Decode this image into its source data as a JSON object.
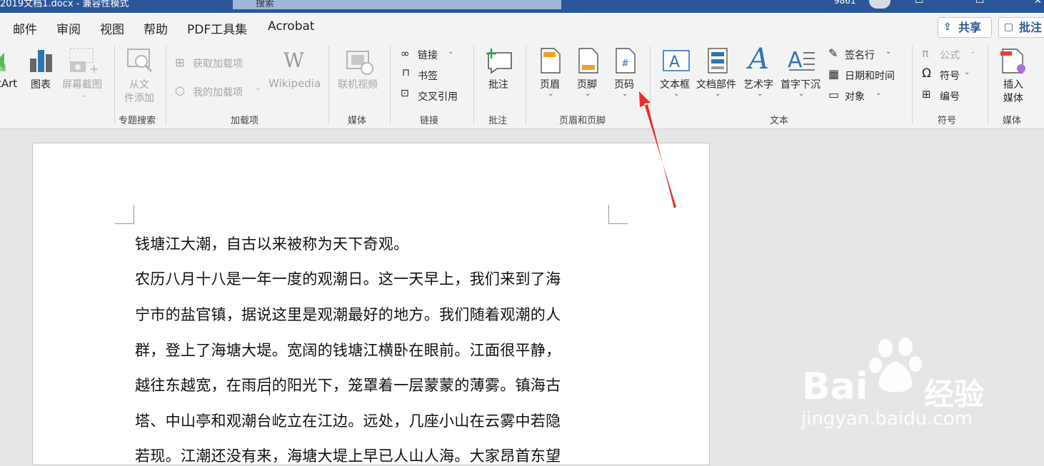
{
  "titlebar": {
    "left_text": "2019文档1.docx - 兼容性模式",
    "search_placeholder": "搜索",
    "user": "9861"
  },
  "tabs": [
    "邮件",
    "审阅",
    "视图",
    "帮助",
    "PDF工具集",
    "Acrobat"
  ],
  "share_label": "共享",
  "comment_label": "批注",
  "ribbon": {
    "smartart": "tArt",
    "chart": "图表",
    "screenshot": "屏幕截图",
    "from_file": [
      "从文",
      "件添加"
    ],
    "get_addins": "获取加载项",
    "my_addins": "我的加载项",
    "wikipedia": "Wikipedia",
    "online_video": "联机视频",
    "link": "链接",
    "bookmark": "书签",
    "cross_ref": "交叉引用",
    "comment": "批注",
    "header": "页眉",
    "footer": "页脚",
    "page_number": "页码",
    "textbox": "文本框",
    "quick_parts": "文档部件",
    "wordart": "艺术字",
    "dropcap": "首字下沉",
    "signature_line": "签名行",
    "date_time": "日期和时间",
    "object": "对象",
    "equation": "公式",
    "symbol": "符号",
    "number": "编号",
    "insert_media": [
      "插入",
      "媒体"
    ]
  },
  "groups": {
    "topic_search": "专题搜索",
    "addins": "加载项",
    "media": "媒体",
    "links": "链接",
    "comments": "批注",
    "header_footer": "页眉和页脚",
    "text": "文本",
    "symbols": "符号",
    "media2": "媒体"
  },
  "document": {
    "paragraphs": [
      "钱塘江大潮，自古以来被称为天下奇观。",
      "农历八月十八是一年一度的观潮日。这一天早上，我们来到了海",
      "宁市的盐官镇，据说这里是观潮最好的地方。我们随着观潮的人",
      "群，登上了海塘大堤。宽阔的钱塘江横卧在眼前。江面很平静，",
      "越往东越宽，在雨后的阳光下，笼罩着一层蒙蒙的薄雾。镇海古",
      "塔、中山亭和观潮台屹立在江边。远处，几座小山在云雾中若隐",
      "若现。江潮还没有来，海塘大堤上早已人山人海。大家昂首东望"
    ]
  },
  "watermark": {
    "brand": "Bai",
    "brand2": "经验",
    "url": "jingyan.baidu.com"
  },
  "colors": {
    "word_blue": "#2b579a",
    "arrow": "#e8302a",
    "icon_blue": "#2e75b6",
    "icon_orange": "#f0a030"
  }
}
